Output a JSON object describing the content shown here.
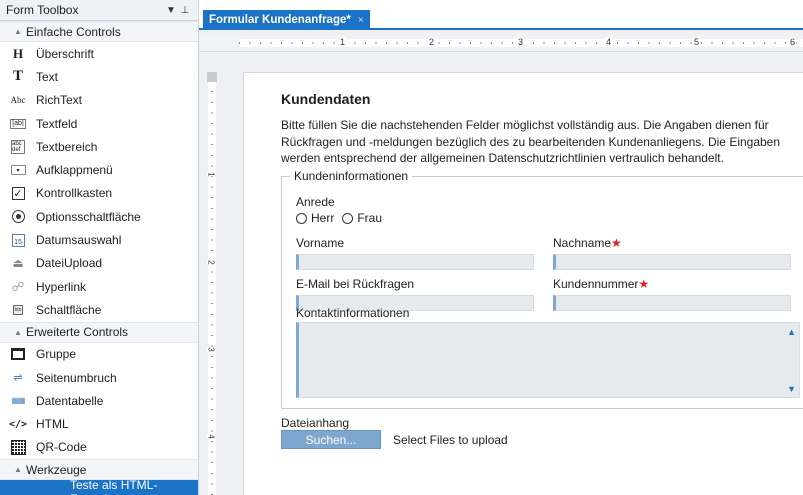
{
  "toolbox": {
    "title": "Form Toolbox",
    "pin": "▾ ⊥",
    "sections": [
      {
        "label": "Einfache Controls",
        "items": [
          {
            "label": "Überschrift",
            "icon": "heading-icon"
          },
          {
            "label": "Text",
            "icon": "text-icon"
          },
          {
            "label": "RichText",
            "icon": "richtext-icon"
          },
          {
            "label": "Textfeld",
            "icon": "textfield-icon"
          },
          {
            "label": "Textbereich",
            "icon": "textarea-icon"
          },
          {
            "label": "Aufklappmenü",
            "icon": "dropdown-icon"
          },
          {
            "label": "Kontrollkasten",
            "icon": "checkbox-icon"
          },
          {
            "label": "Optionsschaltfläche",
            "icon": "radio-icon"
          },
          {
            "label": "Datumsauswahl",
            "icon": "calendar-icon"
          },
          {
            "label": "DateiUpload",
            "icon": "upload-icon"
          },
          {
            "label": "Hyperlink",
            "icon": "link-icon"
          },
          {
            "label": "Schaltfläche",
            "icon": "button-icon"
          }
        ]
      },
      {
        "label": "Erweiterte Controls",
        "items": [
          {
            "label": "Gruppe",
            "icon": "group-icon"
          },
          {
            "label": "Seitenumbruch",
            "icon": "pagebreak-icon"
          },
          {
            "label": "Datentabelle",
            "icon": "datatable-icon"
          },
          {
            "label": "HTML",
            "icon": "html-icon"
          },
          {
            "label": "QR-Code",
            "icon": "qrcode-icon"
          }
        ]
      },
      {
        "label": "Werkzeuge",
        "items": [
          {
            "label": "Teste als HTML-Formular",
            "icon": ""
          }
        ]
      }
    ],
    "icon_glyphs": {
      "heading": "H",
      "text": "T",
      "richtext": "Abc",
      "textfield": "[ab|",
      "textarea": "abc def",
      "dropdown": "▾",
      "checkbox": "✓",
      "calendar": "15",
      "upload": "⏏",
      "link": "🔗",
      "button": "[btn]",
      "pagebreak": "⇌",
      "datatable": "▦▦",
      "html": "</>"
    }
  },
  "tab": {
    "label": "Formular Kundenanfrage*",
    "close": "×"
  },
  "ruler": {
    "h_marks": [
      "1",
      "2",
      "3",
      "4",
      "5",
      "6"
    ],
    "v_marks": [
      "1",
      "2",
      "3",
      "4"
    ]
  },
  "form": {
    "title": "Kundendaten",
    "intro": "Bitte füllen Sie die nachstehenden Felder möglichst vollständig aus. Die Angaben dienen für Rückfragen und -meldungen bezüglich des zu bearbeitenden Kundenanliegens. Die Eingaben werden entsprechend der allgemeinen Datenschutzrichtlinien vertraulich behandelt.",
    "fieldset_legend": "Kundeninformationen",
    "anrede_label": "Anrede",
    "anrede_options": [
      "Herr",
      "Frau"
    ],
    "vorname_label": "Vorname",
    "nachname_label": "Nachname",
    "email_label": "E-Mail bei Rückfragen",
    "kundennummer_label": "Kundennummer",
    "required_mark": "★",
    "kontakt_label": "Kontaktinformationen",
    "scroll_up": "▲",
    "scroll_down": "▼",
    "attachment_label": "Dateianhang",
    "browse_button": "Suchen...",
    "upload_hint": "Select Files to upload"
  }
}
